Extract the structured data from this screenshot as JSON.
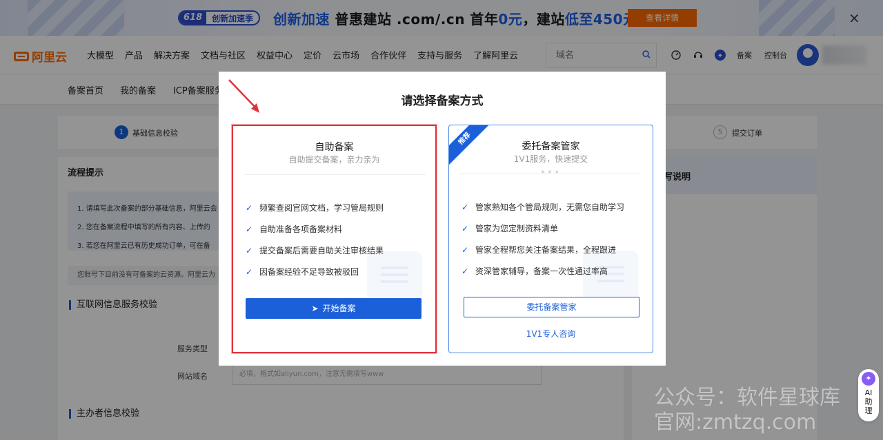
{
  "banner": {
    "badge_number": "618",
    "badge_text": "创新加速季",
    "headline_blue": "创新加速",
    "headline_mid": " 普惠建站  .com/.cn 首年",
    "headline_price0": "0元",
    "headline_mid2": "，建站",
    "headline_low": "低至450元",
    "cta": "查看详情",
    "close": "×"
  },
  "nav": {
    "logo": "阿里云",
    "menu": [
      "大模型",
      "产品",
      "解决方案",
      "文档与社区",
      "权益中心",
      "定价",
      "云市场",
      "合作伙伴",
      "支持与服务",
      "了解阿里云"
    ],
    "search_placeholder": "域名",
    "beian": "备案",
    "console": "控制台"
  },
  "subnav": {
    "items": [
      "备案首页",
      "我的备案",
      "ICP备案服务"
    ]
  },
  "steps": {
    "step1_num": "1",
    "step1_label": "基础信息校验",
    "step5_num": "5",
    "step5_label": "提交订单"
  },
  "panel": {
    "title": "流程提示",
    "tips": [
      "1. 请填写此次备案的部分基础信息，阿里云会",
      "2. 您在备案流程中填写的所有内容、上传的",
      "3. 若您在阿里云已有历史成功订单，可在备"
    ],
    "notice": "您账号下目前没有可备案的云资源。阿里云为",
    "section1": "互联网信息服务校验",
    "service_type_label": "服务类型",
    "domain_label": "网站域名",
    "domain_placeholder": "必填，格式如aliyun.com，注意无需填写www",
    "section2": "主办者信息校验"
  },
  "right_panel": {
    "title": "写说明"
  },
  "modal": {
    "title": "请选择备案方式",
    "self": {
      "title": "自助备案",
      "subtitle": "自助提交备案，亲力亲为",
      "items": [
        "频繁查阅官网文档，学习管局规则",
        "自助准备各项备案材料",
        "提交备案后需要自助关注审核结果",
        "因备案经验不足导致被驳回"
      ],
      "button": "开始备案"
    },
    "managed": {
      "ribbon": "推荐",
      "title": "委托备案管家",
      "subtitle": "1V1服务，快速提交",
      "stars": "★★★",
      "items": [
        "管家熟知各个管局规则，无需您自助学习",
        "管家为您定制资料清单",
        "管家全程帮您关注备案结果，全程跟进",
        "资深管家辅导，备案一次性通过率高"
      ],
      "button": "委托备案管家",
      "link": "1V1专人咨询"
    }
  },
  "ai_assistant": {
    "icon_glyph": "✦",
    "label": "AI助理"
  },
  "watermark": {
    "line1": "公众号：软件星球库",
    "line2": "官网:zmtzq.com"
  },
  "colors": {
    "brand_orange": "#ff6a00",
    "primary_blue": "#1b5fd9",
    "highlight_red": "#e0333a"
  }
}
